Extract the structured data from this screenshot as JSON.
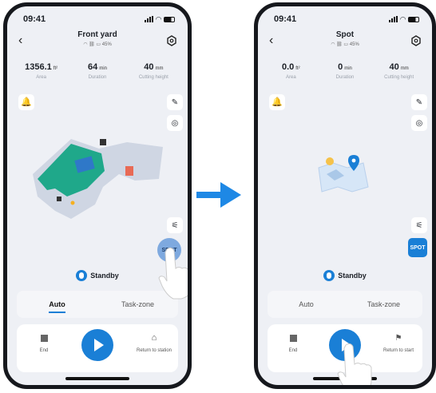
{
  "left": {
    "status": {
      "time": "09:41"
    },
    "title": "Front yard",
    "battery": "45%",
    "stats": [
      {
        "value": "1356.1",
        "unit": "ft²",
        "label": "Area"
      },
      {
        "value": "64",
        "unit": "min",
        "label": "Duration"
      },
      {
        "value": "40",
        "unit": "mm",
        "label": "Cutting height"
      }
    ],
    "spot_label": "SPOT",
    "standby": "Standby",
    "tabs": [
      {
        "label": "Auto"
      },
      {
        "label": "Task-zone"
      }
    ],
    "controls": {
      "end": "End",
      "return": "Return to station"
    }
  },
  "right": {
    "status": {
      "time": "09:41"
    },
    "title": "Spot",
    "battery": "45%",
    "stats": [
      {
        "value": "0.0",
        "unit": "ft²",
        "label": "Area"
      },
      {
        "value": "0",
        "unit": "min",
        "label": "Duration"
      },
      {
        "value": "40",
        "unit": "mm",
        "label": "Cutting height"
      }
    ],
    "spot_label": "SPOT",
    "standby": "Standby",
    "tabs": [
      {
        "label": "Auto"
      },
      {
        "label": "Task-zone"
      }
    ],
    "controls": {
      "end": "End",
      "return": "Return to start"
    }
  },
  "colors": {
    "accent": "#1a7fd6",
    "mowed_area": "#1fa88a",
    "map_gray": "#cfd6e3"
  },
  "icons": [
    "back-chevron-icon",
    "settings-hex-icon",
    "wifi-icon",
    "link-icon",
    "battery-icon",
    "bell-icon",
    "edit-map-icon",
    "locate-icon",
    "sliders-icon",
    "stop-icon",
    "play-icon",
    "home-icon",
    "flag-icon",
    "tap-hand-icon",
    "arrow-right-icon"
  ]
}
